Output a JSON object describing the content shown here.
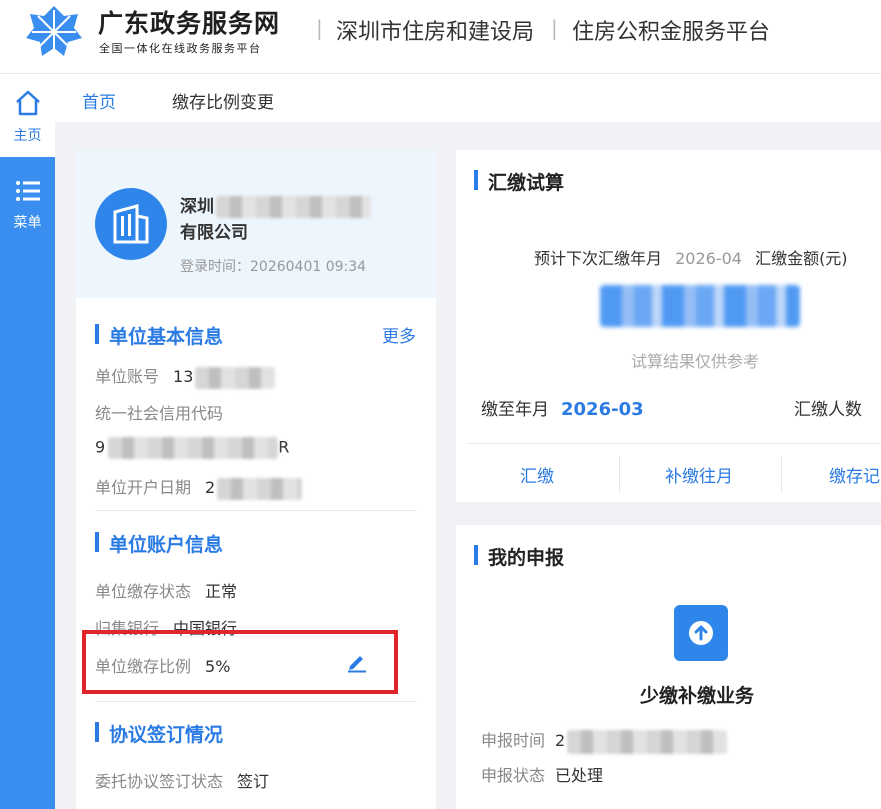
{
  "header": {
    "brand_title": "广东政务服务网",
    "brand_subtitle": "全国一体化在线政务服务平台",
    "dept": "深圳市住房和建设局",
    "platform": "住房公积金服务平台",
    "separator": "|"
  },
  "rail": {
    "home_label": "主页",
    "menu_label": "菜单"
  },
  "tabs": [
    {
      "label": "首页"
    },
    {
      "label": "缴存比例变更"
    }
  ],
  "profile": {
    "company_prefix": "深圳",
    "company_suffix": "有限公司",
    "login_time": "登录时间：20260401 09:34"
  },
  "basic_info": {
    "title": "单位基本信息",
    "more": "更多",
    "account_label": "单位账号",
    "account_value_prefix": "13",
    "credit_code_label": "统一社会信用代码",
    "credit_code_prefix": "9",
    "credit_code_suffix": "R",
    "open_date_label": "单位开户日期",
    "open_date_prefix": "2"
  },
  "account_info": {
    "title": "单位账户信息",
    "status_label": "单位缴存状态",
    "status_value": "正常",
    "bank_label": "归集银行",
    "bank_value": "中国银行",
    "ratio_label": "单位缴存比例",
    "ratio_value": "5%"
  },
  "agreement": {
    "title": "协议签订情况",
    "label": "委托协议签订状态",
    "value": "签订"
  },
  "calc": {
    "title": "汇缴试算",
    "next_label": "预计下次汇缴年月",
    "next_value": "2026-04",
    "amount_label": "汇缴金额(元)",
    "note": "试算结果仅供参考",
    "paid_to_label": "缴至年月",
    "paid_to_value": "2026-03",
    "people_label": "汇缴人数",
    "actions": [
      "汇缴",
      "补缴往月",
      "缴存记"
    ]
  },
  "report": {
    "title": "我的申报",
    "biz_name": "少缴补缴业务",
    "time_label": "申报时间",
    "time_prefix": "2",
    "status_label": "申报状态",
    "status_value": "已处理"
  },
  "colors": {
    "primary": "#2b7be4",
    "rail": "#3a8ef0",
    "highlight": "#e0262a",
    "profile_bg": "#edf5fd",
    "canvas_bg": "#f0f2f5"
  }
}
